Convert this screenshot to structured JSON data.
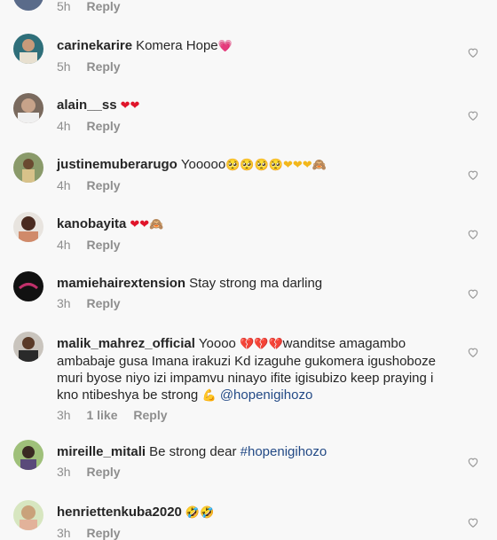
{
  "top_meta": {
    "time": "5h",
    "reply": "Reply"
  },
  "comments": [
    {
      "username": "carinekarire",
      "text": "Komera Hope",
      "emoji": "💗",
      "time": "5h",
      "reply": "Reply"
    },
    {
      "username": "alain__ss",
      "text": "",
      "emoji": "❤❤",
      "time": "4h",
      "reply": "Reply"
    },
    {
      "username": "justinemuberarugo",
      "text": "Yooooo",
      "emoji": "🥺🥺🥺🥺❤❤❤🙈",
      "time": "4h",
      "reply": "Reply"
    },
    {
      "username": "kanobayita",
      "text": "",
      "emoji": "❤❤🙈",
      "time": "4h",
      "reply": "Reply"
    },
    {
      "username": "mamiehairextension",
      "text": "Stay strong ma darling",
      "emoji": "",
      "time": "3h",
      "reply": "Reply"
    },
    {
      "username": "malik_mahrez_official",
      "text_a": "Yoooo",
      "emoji_a": "💔💔💔",
      "text_b": "wanditse amagambo ambabaje gusa Imana irakuzi Kd izaguhe gukomera igushoboze muri byose niyo izi impamvu ninayo ifite igisubizo keep praying i kno ntibeshya be strong",
      "emoji_b": "💪",
      "mention": "@hopenigihozo",
      "time": "3h",
      "likes": "1 like",
      "reply": "Reply"
    },
    {
      "username": "mireille_mitali",
      "text": "Be strong dear",
      "hashtag": "#hopenigihozo",
      "time": "3h",
      "reply": "Reply"
    },
    {
      "username": "henriettenkuba2020",
      "text": "",
      "emoji": "🤣🤣",
      "time": "3h",
      "reply": "Reply"
    }
  ],
  "icons": {
    "like": "heart-outline-icon"
  }
}
